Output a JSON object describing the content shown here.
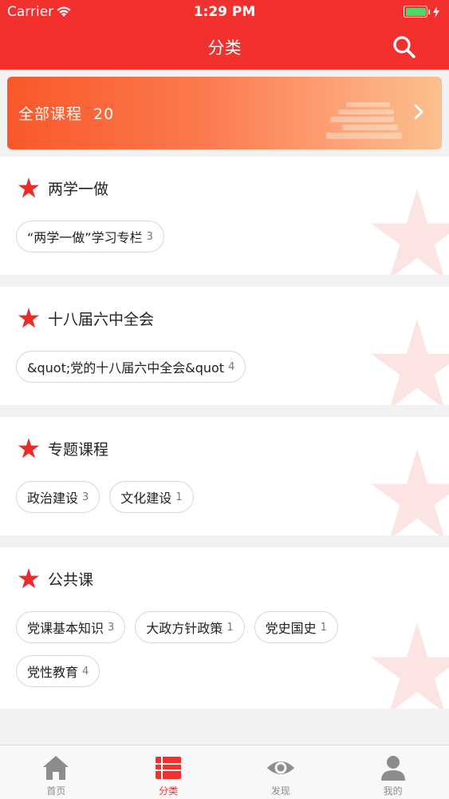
{
  "status_bar": {
    "carrier": "Carrier",
    "time": "1:29 PM"
  },
  "nav": {
    "title": "分类"
  },
  "banner": {
    "label": "全部课程",
    "count": "20"
  },
  "sections": [
    {
      "title": "两学一做",
      "tags": [
        {
          "name": "“两学一做”学习专栏",
          "count": "3"
        }
      ]
    },
    {
      "title": "十八届六中全会",
      "tags": [
        {
          "name": "&quot;党的十八届六中全会&quot",
          "count": "4"
        }
      ]
    },
    {
      "title": "专题课程",
      "tags": [
        {
          "name": "政治建设",
          "count": "3"
        },
        {
          "name": "文化建设",
          "count": "1"
        }
      ]
    },
    {
      "title": "公共课",
      "tags": [
        {
          "name": "党课基本知识",
          "count": "3"
        },
        {
          "name": "大政方针政策",
          "count": "1"
        },
        {
          "name": "党史国史",
          "count": "1"
        },
        {
          "name": "党性教育",
          "count": "4"
        }
      ]
    }
  ],
  "tabs": [
    {
      "label": "首页",
      "icon": "home-icon"
    },
    {
      "label": "分类",
      "icon": "list-icon",
      "active": true
    },
    {
      "label": "发现",
      "icon": "eye-icon"
    },
    {
      "label": "我的",
      "icon": "person-icon"
    }
  ],
  "colors": {
    "brand": "#f2302e",
    "inactive": "#8c8c8c"
  }
}
